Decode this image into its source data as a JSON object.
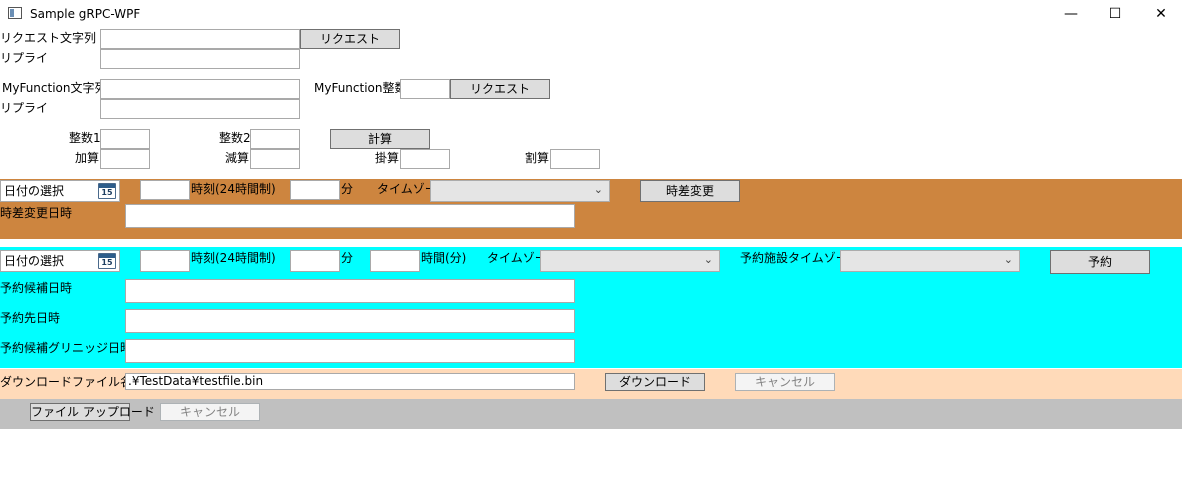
{
  "window": {
    "title": "Sample gRPC-WPF",
    "minimize_glyph": "—",
    "maximize_glyph": "☐",
    "close_glyph": "✕"
  },
  "section1": {
    "request_string_label": "リクエスト文字列",
    "request_string_value": "",
    "request_button": "リクエスト",
    "reply_label": "リプライ",
    "reply_value": ""
  },
  "section2": {
    "myfunction_string_label": "MyFunction文字列",
    "myfunction_string_value": "",
    "myfunction_int_label": "MyFunction整数",
    "myfunction_int_value": "",
    "request_button": "リクエスト",
    "reply_label": "リプライ",
    "reply_value": ""
  },
  "section3": {
    "int1_label": "整数1",
    "int2_label": "整数2",
    "calc_button": "計算",
    "add_label": "加算",
    "sub_label": "減算",
    "mul_label": "掛算",
    "div_label": "割算"
  },
  "timezone_section": {
    "bg_color": "#cd853f",
    "date_picker_text": "日付の選択",
    "calendar_day": "15",
    "time_label": "時刻(24時間制)",
    "minute_label": "分",
    "timezone_label": "タイムゾーン",
    "timezone_selected": "",
    "convert_button": "時差変更",
    "converted_label": "時差変更日時",
    "converted_value": ""
  },
  "reservation_section": {
    "bg_color": "#00ffff",
    "date_picker_text": "日付の選択",
    "calendar_day": "15",
    "time_label": "時刻(24時間制)",
    "minute_label": "分",
    "duration_label": "時間(分)",
    "timezone_label": "タイムゾーン",
    "facility_timezone_label": "予約施設タイムゾーン",
    "reserve_button": "予約",
    "candidate_label": "予約候補日時",
    "target_label": "予約先日時",
    "candidate_gmt_label": "予約候補グリニッジ日時"
  },
  "download_section": {
    "bg_color": "#ffdab9",
    "filename_label": "ダウンロードファイル名",
    "filename_value": ".¥TestData¥testfile.bin",
    "download_button": "ダウンロード",
    "cancel_button": "キャンセル"
  },
  "upload_section": {
    "bg_color": "#c0c0c0",
    "upload_button": "ファイル アップロード",
    "cancel_button": "キャンセル"
  }
}
